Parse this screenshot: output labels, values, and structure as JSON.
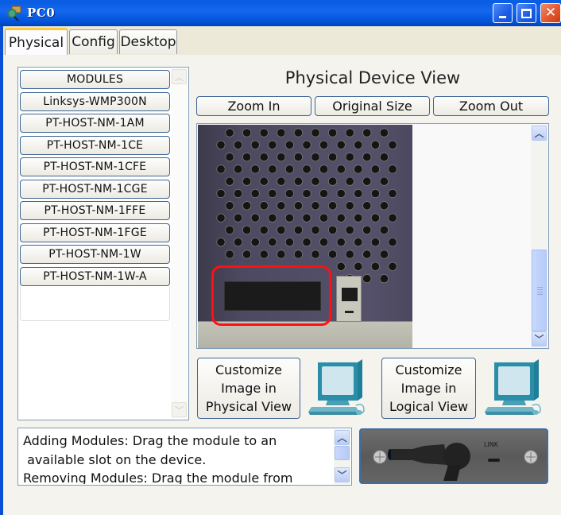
{
  "window": {
    "title": "PC0",
    "icon": "packet-tracer-pc-icon",
    "controls": {
      "minimize": "minimize-icon",
      "maximize": "maximize-icon",
      "close": "close-icon"
    }
  },
  "tabs": [
    {
      "label": "Physical",
      "active": true
    },
    {
      "label": "Config",
      "active": false
    },
    {
      "label": "Desktop",
      "active": false
    }
  ],
  "modules": {
    "header": "MODULES",
    "items": [
      "Linksys-WMP300N",
      "PT-HOST-NM-1AM",
      "PT-HOST-NM-1CE",
      "PT-HOST-NM-1CFE",
      "PT-HOST-NM-1CGE",
      "PT-HOST-NM-1FFE",
      "PT-HOST-NM-1FGE",
      "PT-HOST-NM-1W",
      "PT-HOST-NM-1W-A"
    ]
  },
  "physical_view": {
    "title": "Physical Device View",
    "zoom_in": "Zoom In",
    "original_size": "Original Size",
    "zoom_out": "Zoom Out",
    "highlight_color": "#ff1010"
  },
  "customize": {
    "physical": {
      "line1": "Customize",
      "line2": "Image in",
      "line3": "Physical View"
    },
    "logical": {
      "line1": "Customize",
      "line2": "Image in",
      "line3": "Logical View"
    }
  },
  "help": {
    "line1": "Adding Modules: Drag the module to an",
    "line2": " available slot on the device.",
    "line3": "Removing Modules: Drag the module from"
  },
  "module_preview": {
    "label": "LINK"
  }
}
